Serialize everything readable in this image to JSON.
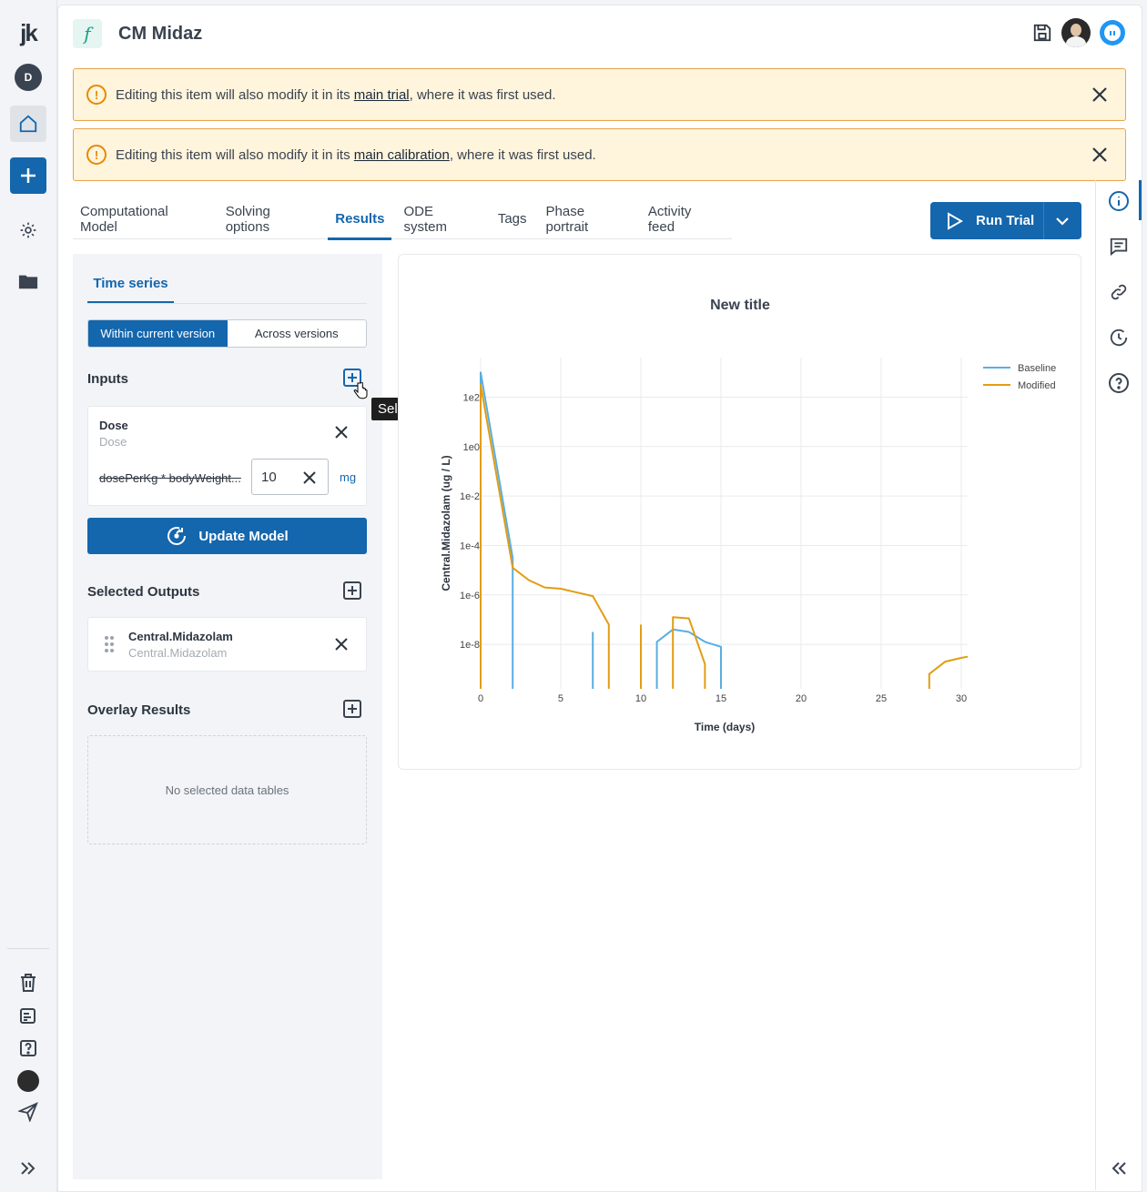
{
  "rail": {
    "logo": "jk",
    "user_initial": "D"
  },
  "header": {
    "title": "CM Midaz",
    "model_icon_glyph": "f"
  },
  "alerts": [
    {
      "prefix": "Editing this item will also modify it in its ",
      "link": "main trial",
      "suffix": ", where it was first used."
    },
    {
      "prefix": "Editing this item will also modify it in its ",
      "link": "main calibration",
      "suffix": ", where it was first used."
    }
  ],
  "tabs": [
    {
      "label": "Computational Model",
      "active": false
    },
    {
      "label": "Solving options",
      "active": false
    },
    {
      "label": "Results",
      "active": true
    },
    {
      "label": "ODE system",
      "active": false
    },
    {
      "label": "Tags",
      "active": false
    },
    {
      "label": "Phase portrait",
      "active": false
    },
    {
      "label": "Activity feed",
      "active": false
    }
  ],
  "run_button": {
    "label": "Run Trial"
  },
  "panel": {
    "subtab": "Time series",
    "segmented": {
      "option1": "Within current version",
      "option2": "Across versions",
      "selected": "Within current version"
    },
    "inputs_title": "Inputs",
    "tooltip": "Select inputs",
    "dose": {
      "name": "Dose",
      "subtitle": "Dose",
      "expression": "dosePerKg * bodyWeight...",
      "value": "10",
      "unit": "mg"
    },
    "update_button": "Update Model",
    "outputs_title": "Selected Outputs",
    "output": {
      "name": "Central.Midazolam",
      "subtitle": "Central.Midazolam"
    },
    "overlay_title": "Overlay Results",
    "overlay_empty": "No selected data tables"
  },
  "chart_data": {
    "type": "line",
    "title": "New title",
    "xlabel": "Time (days)",
    "ylabel": "Central.Midazolam (ug / L)",
    "y_scale": "log",
    "xlim": [
      0,
      30.4
    ],
    "ylim_log10": [
      -9.8,
      3.6
    ],
    "x_ticks": [
      0,
      5,
      10,
      15,
      20,
      25,
      30
    ],
    "y_ticks": [
      {
        "exp": 2,
        "label": "1e2"
      },
      {
        "exp": 0,
        "label": "1e0"
      },
      {
        "exp": -2,
        "label": "1e-2"
      },
      {
        "exp": -4,
        "label": "1e-4"
      },
      {
        "exp": -6,
        "label": "1e-6"
      },
      {
        "exp": -8,
        "label": "1e-8"
      }
    ],
    "grid": true,
    "legend_position": "top-right",
    "series": [
      {
        "name": "Baseline",
        "color": "#5aaee0",
        "segments": [
          [
            [
              0,
              -9.8
            ],
            [
              0,
              3.0
            ],
            [
              2,
              -4.5
            ],
            [
              2,
              -9.8
            ]
          ],
          [
            [
              7,
              -7.5
            ],
            [
              7,
              -9.8
            ]
          ],
          [
            [
              11,
              -9.8
            ],
            [
              11,
              -7.9
            ],
            [
              12,
              -7.4
            ],
            [
              13,
              -7.5
            ],
            [
              14,
              -7.9
            ],
            [
              15,
              -8.1
            ],
            [
              15,
              -9.8
            ]
          ]
        ]
      },
      {
        "name": "Modified",
        "color": "#e19d13",
        "segments": [
          [
            [
              0,
              -9.8
            ],
            [
              0,
              2.5
            ],
            [
              2,
              -4.9
            ],
            [
              3,
              -5.4
            ],
            [
              4,
              -5.7
            ],
            [
              5,
              -5.75
            ],
            [
              7,
              -6.05
            ],
            [
              8,
              -7.2
            ],
            [
              8,
              -9.8
            ]
          ],
          [
            [
              10,
              -7.2
            ],
            [
              10,
              -9.8
            ]
          ],
          [
            [
              12,
              -9.8
            ],
            [
              12,
              -6.9
            ],
            [
              13,
              -6.95
            ],
            [
              14,
              -8.8
            ],
            [
              14,
              -9.8
            ]
          ],
          [
            [
              28,
              -9.8
            ],
            [
              28,
              -9.2
            ],
            [
              29,
              -8.7
            ],
            [
              30,
              -8.55
            ],
            [
              30.4,
              -8.5
            ]
          ]
        ]
      }
    ]
  }
}
